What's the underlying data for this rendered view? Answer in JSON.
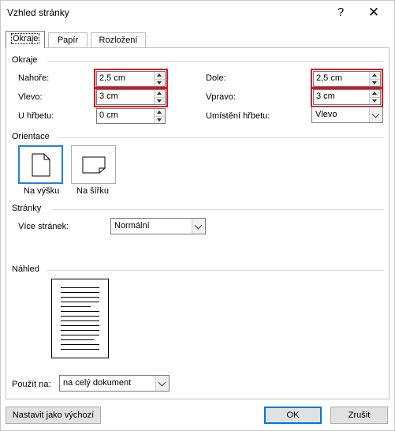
{
  "window": {
    "title": "Vzhled stránky",
    "help_glyph": "?",
    "close_glyph": "✕"
  },
  "tabs": [
    {
      "label": "Okraje",
      "active": true
    },
    {
      "label": "Papír",
      "active": false
    },
    {
      "label": "Rozložení",
      "active": false
    }
  ],
  "margins": {
    "group_label": "Okraje",
    "top": {
      "label": "Nahoře:",
      "value": "2,5 cm"
    },
    "bottom": {
      "label": "Dole:",
      "value": "2,5 cm"
    },
    "left": {
      "label": "Vlevo:",
      "value": "3 cm"
    },
    "right": {
      "label": "Vpravo:",
      "value": "3 cm"
    },
    "gutter": {
      "label": "U hřbetu:",
      "value": "0 cm"
    },
    "gutter_position": {
      "label": "Umístění hřbetu:",
      "value": "Vlevo"
    }
  },
  "orientation": {
    "group_label": "Orientace",
    "portrait": "Na výšku",
    "landscape": "Na šířku",
    "selected": "portrait"
  },
  "pages": {
    "group_label": "Stránky",
    "multiple_label": "Více stránek:",
    "multiple_value": "Normální"
  },
  "preview": {
    "group_label": "Náhled"
  },
  "apply": {
    "label": "Použít na:",
    "value": "na celý dokument"
  },
  "buttons": {
    "set_default": "Nastavit jako výchozí",
    "ok": "OK",
    "cancel": "Zrušit"
  },
  "highlight_color": "#e01020"
}
